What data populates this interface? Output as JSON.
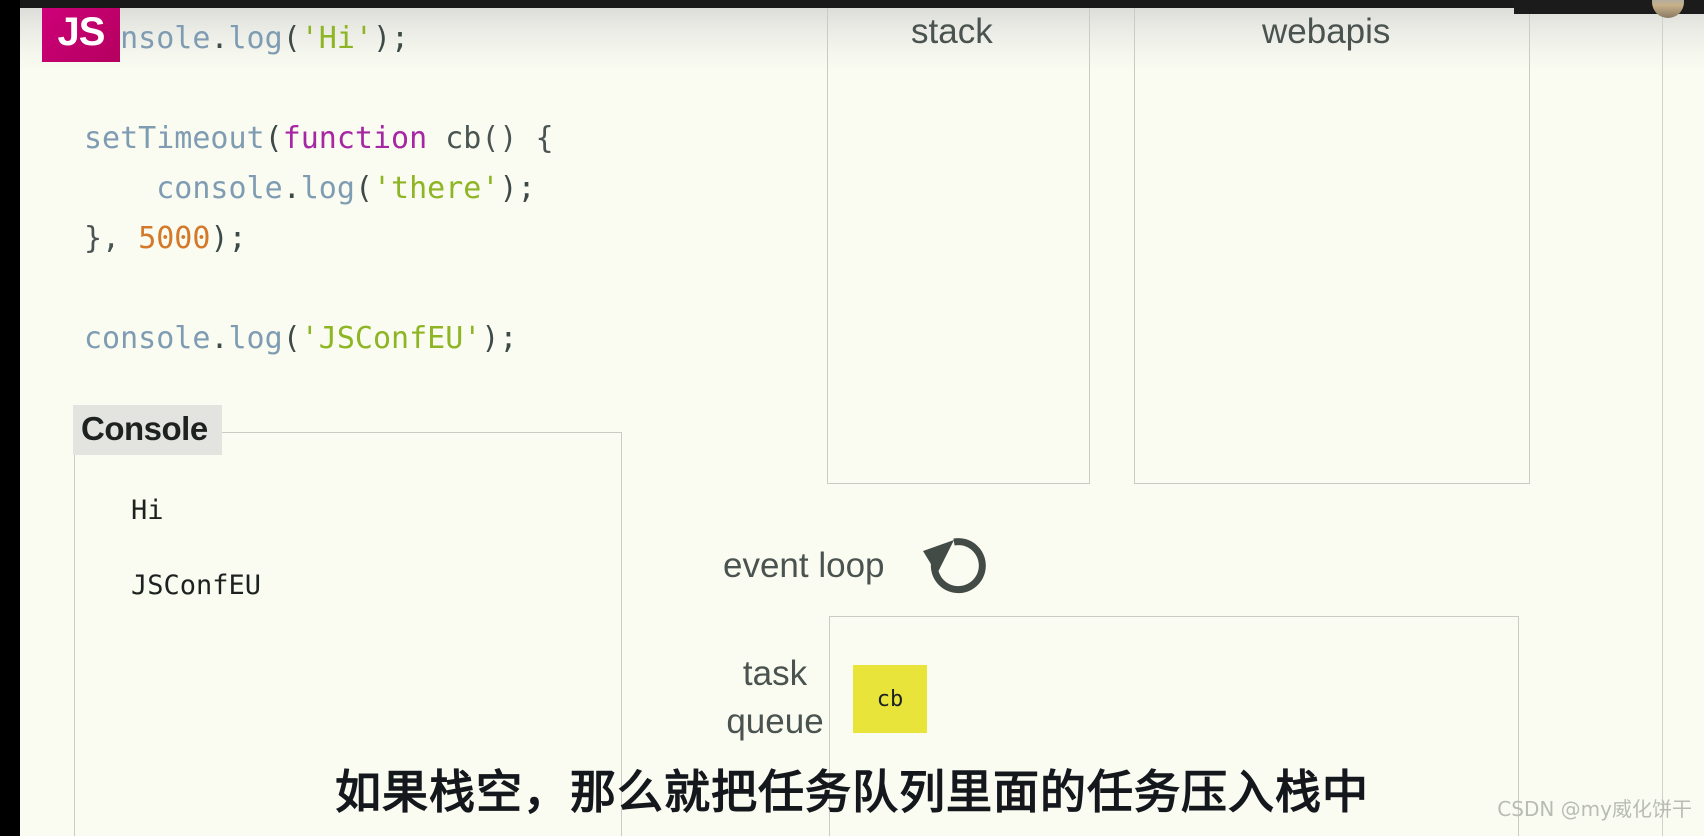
{
  "slide": {
    "background_color": "#fafcf1",
    "logo": {
      "text": "JS",
      "color": "#c4006e",
      "name": "javascript-logo"
    }
  },
  "code": {
    "lines": [
      {
        "id": "line1",
        "tokens": [
          {
            "t": "console",
            "k": "ident"
          },
          {
            "t": ".",
            "k": "punct"
          },
          {
            "t": "log",
            "k": "ident"
          },
          {
            "t": "(",
            "k": "punct"
          },
          {
            "t": "'Hi'",
            "k": "string"
          },
          {
            "t": ");",
            "k": "punct"
          }
        ]
      },
      {
        "id": "line2",
        "tokens": []
      },
      {
        "id": "line3",
        "tokens": [
          {
            "t": "setTimeout",
            "k": "ident"
          },
          {
            "t": "(",
            "k": "punct"
          },
          {
            "t": "function",
            "k": "kw"
          },
          {
            "t": " cb() {",
            "k": "plain"
          }
        ]
      },
      {
        "id": "line4",
        "tokens": [
          {
            "t": "    ",
            "k": "plain"
          },
          {
            "t": "console",
            "k": "ident"
          },
          {
            "t": ".",
            "k": "punct"
          },
          {
            "t": "log",
            "k": "ident"
          },
          {
            "t": "(",
            "k": "punct"
          },
          {
            "t": "'there'",
            "k": "string"
          },
          {
            "t": ");",
            "k": "punct"
          }
        ]
      },
      {
        "id": "line5",
        "tokens": [
          {
            "t": "}, ",
            "k": "plain"
          },
          {
            "t": "5000",
            "k": "num"
          },
          {
            "t": ");",
            "k": "punct"
          }
        ]
      },
      {
        "id": "line6",
        "tokens": []
      },
      {
        "id": "line7",
        "tokens": [
          {
            "t": "console",
            "k": "ident"
          },
          {
            "t": ".",
            "k": "punct"
          },
          {
            "t": "log",
            "k": "ident"
          },
          {
            "t": "(",
            "k": "punct"
          },
          {
            "t": "'JSConfEU'",
            "k": "string"
          },
          {
            "t": ");",
            "k": "punct"
          }
        ]
      }
    ],
    "colors": {
      "ident": "#7f9cb3",
      "string": "#8db524",
      "keyword": "#a626a4",
      "number": "#d4792a",
      "punct": "#3d4a47"
    }
  },
  "console_panel": {
    "title": "Console",
    "lines": [
      "Hi",
      "JSConfEU"
    ]
  },
  "stack": {
    "label": "stack",
    "frames": []
  },
  "webapis": {
    "label": "webapis",
    "entries": []
  },
  "event_loop": {
    "label": "event loop",
    "icon": "circular-arrow-icon"
  },
  "task_queue": {
    "label_line1": "task",
    "label_line2": "queue",
    "items": [
      {
        "label": "cb",
        "color": "#e8e43a"
      }
    ]
  },
  "subtitle": {
    "text": "如果栈空，那么就把任务队列里面的任务压入栈中"
  },
  "watermark": {
    "text": "CSDN @my威化饼干"
  }
}
